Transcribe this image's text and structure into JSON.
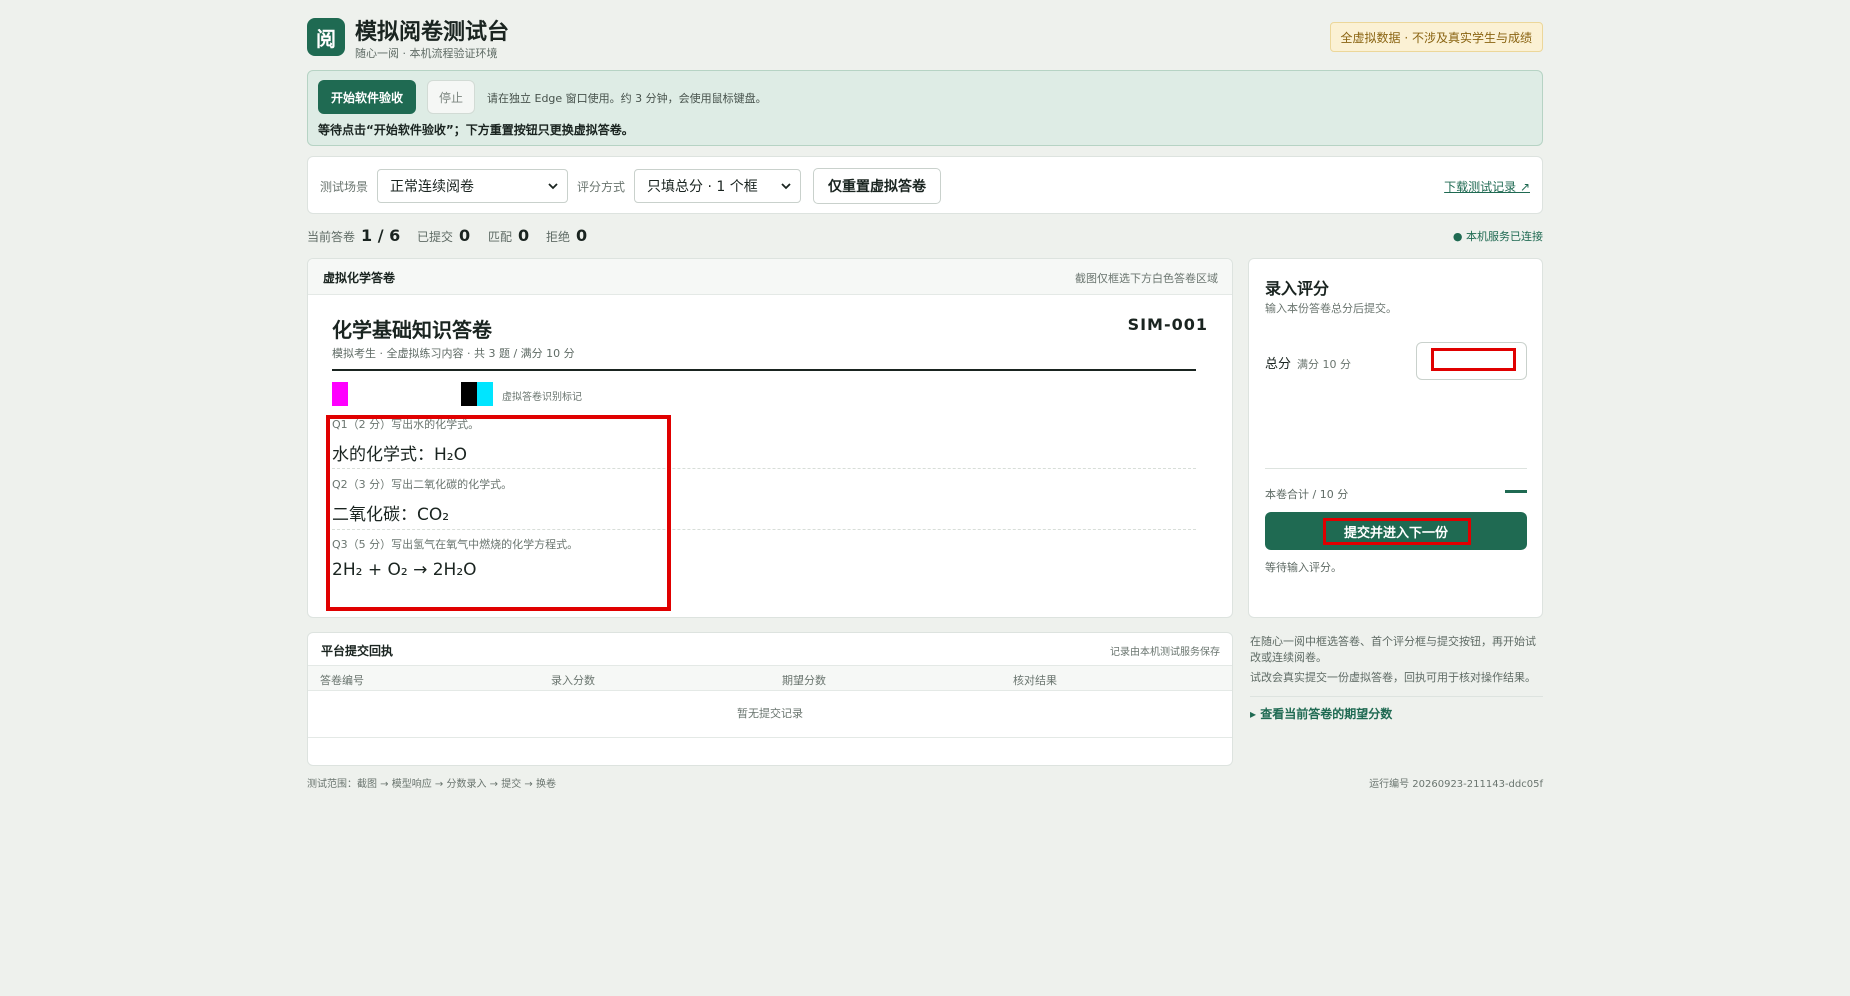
{
  "header": {
    "logo_char": "阅",
    "title": "模拟阅卷测试台",
    "subtitle": "随心一阅 · 本机流程验证环境",
    "badge": "全虚拟数据 · 不涉及真实学生与成绩"
  },
  "run_panel": {
    "start_label": "开始软件验收",
    "stop_label": "停止",
    "hint": "请在独立 Edge 窗口使用。约 3 分钟，会使用鼠标键盘。",
    "status": "等待点击“开始软件验收”；下方重置按钮只更换虚拟答卷。"
  },
  "controls": {
    "scenario_label": "测试场景",
    "scenario_value": "正常连续阅卷",
    "scoring_label": "评分方式",
    "scoring_value": "只填总分 · 1 个框",
    "reset_label": "仅重置虚拟答卷",
    "download_label": "下载测试记录 ↗"
  },
  "stats": {
    "current_label": "当前答卷",
    "current_value": "1 / 6",
    "submitted_label": "已提交",
    "submitted_value": "0",
    "matched_label": "匹配",
    "matched_value": "0",
    "rejected_label": "拒绝",
    "rejected_value": "0",
    "service_status": "● 本机服务已连接"
  },
  "paper": {
    "card_title": "虚拟化学答卷",
    "card_note": "截图仅框选下方白色答卷区域",
    "exam_title": "化学基础知识答卷",
    "exam_id": "SIM-001",
    "exam_meta": "模拟考生 · 全虚拟练习内容 · 共 3 题 / 满分 10 分",
    "marker_note": "虚拟答卷识别标记",
    "marker_colors": [
      "#ff00ff",
      "#000000",
      "#00e5ff"
    ],
    "questions": [
      {
        "prompt": "Q1（2 分）写出水的化学式。",
        "answer": "水的化学式：H₂O"
      },
      {
        "prompt": "Q2（3 分）写出二氧化碳的化学式。",
        "answer": "二氧化碳：CO₂"
      },
      {
        "prompt": "Q3（5 分）写出氢气在氧气中燃烧的化学方程式。",
        "answer": "2H₂ + O₂ → 2H₂O"
      }
    ]
  },
  "receipt": {
    "title": "平台提交回执",
    "note": "记录由本机测试服务保存",
    "columns": [
      "答卷编号",
      "录入分数",
      "期望分数",
      "核对结果"
    ],
    "empty": "暂无提交记录"
  },
  "score_panel": {
    "title": "录入评分",
    "subtitle": "输入本份答卷总分后提交。",
    "total_label": "总分",
    "total_hint": "满分 10 分",
    "total_value": "",
    "sum_label": "本卷合计 / 10 分",
    "submit_label": "提交并进入下一份",
    "wait_text": "等待输入评分。"
  },
  "side_notes": {
    "note1": "在随心一阅中框选答卷、首个评分框与提交按钮，再开始试改或连续阅卷。",
    "note2": "试改会真实提交一份虚拟答卷，回执可用于核对操作结果。",
    "expected_link": "▸ 查看当前答卷的期望分数"
  },
  "footer": {
    "scope": "测试范围：截图 → 模型响应 → 分数录入 → 提交 → 换卷",
    "run_id": "运行编号 20260923-211143-ddc05f"
  },
  "colors": {
    "accent": "#1f6a52",
    "highlight": "#e00000"
  }
}
